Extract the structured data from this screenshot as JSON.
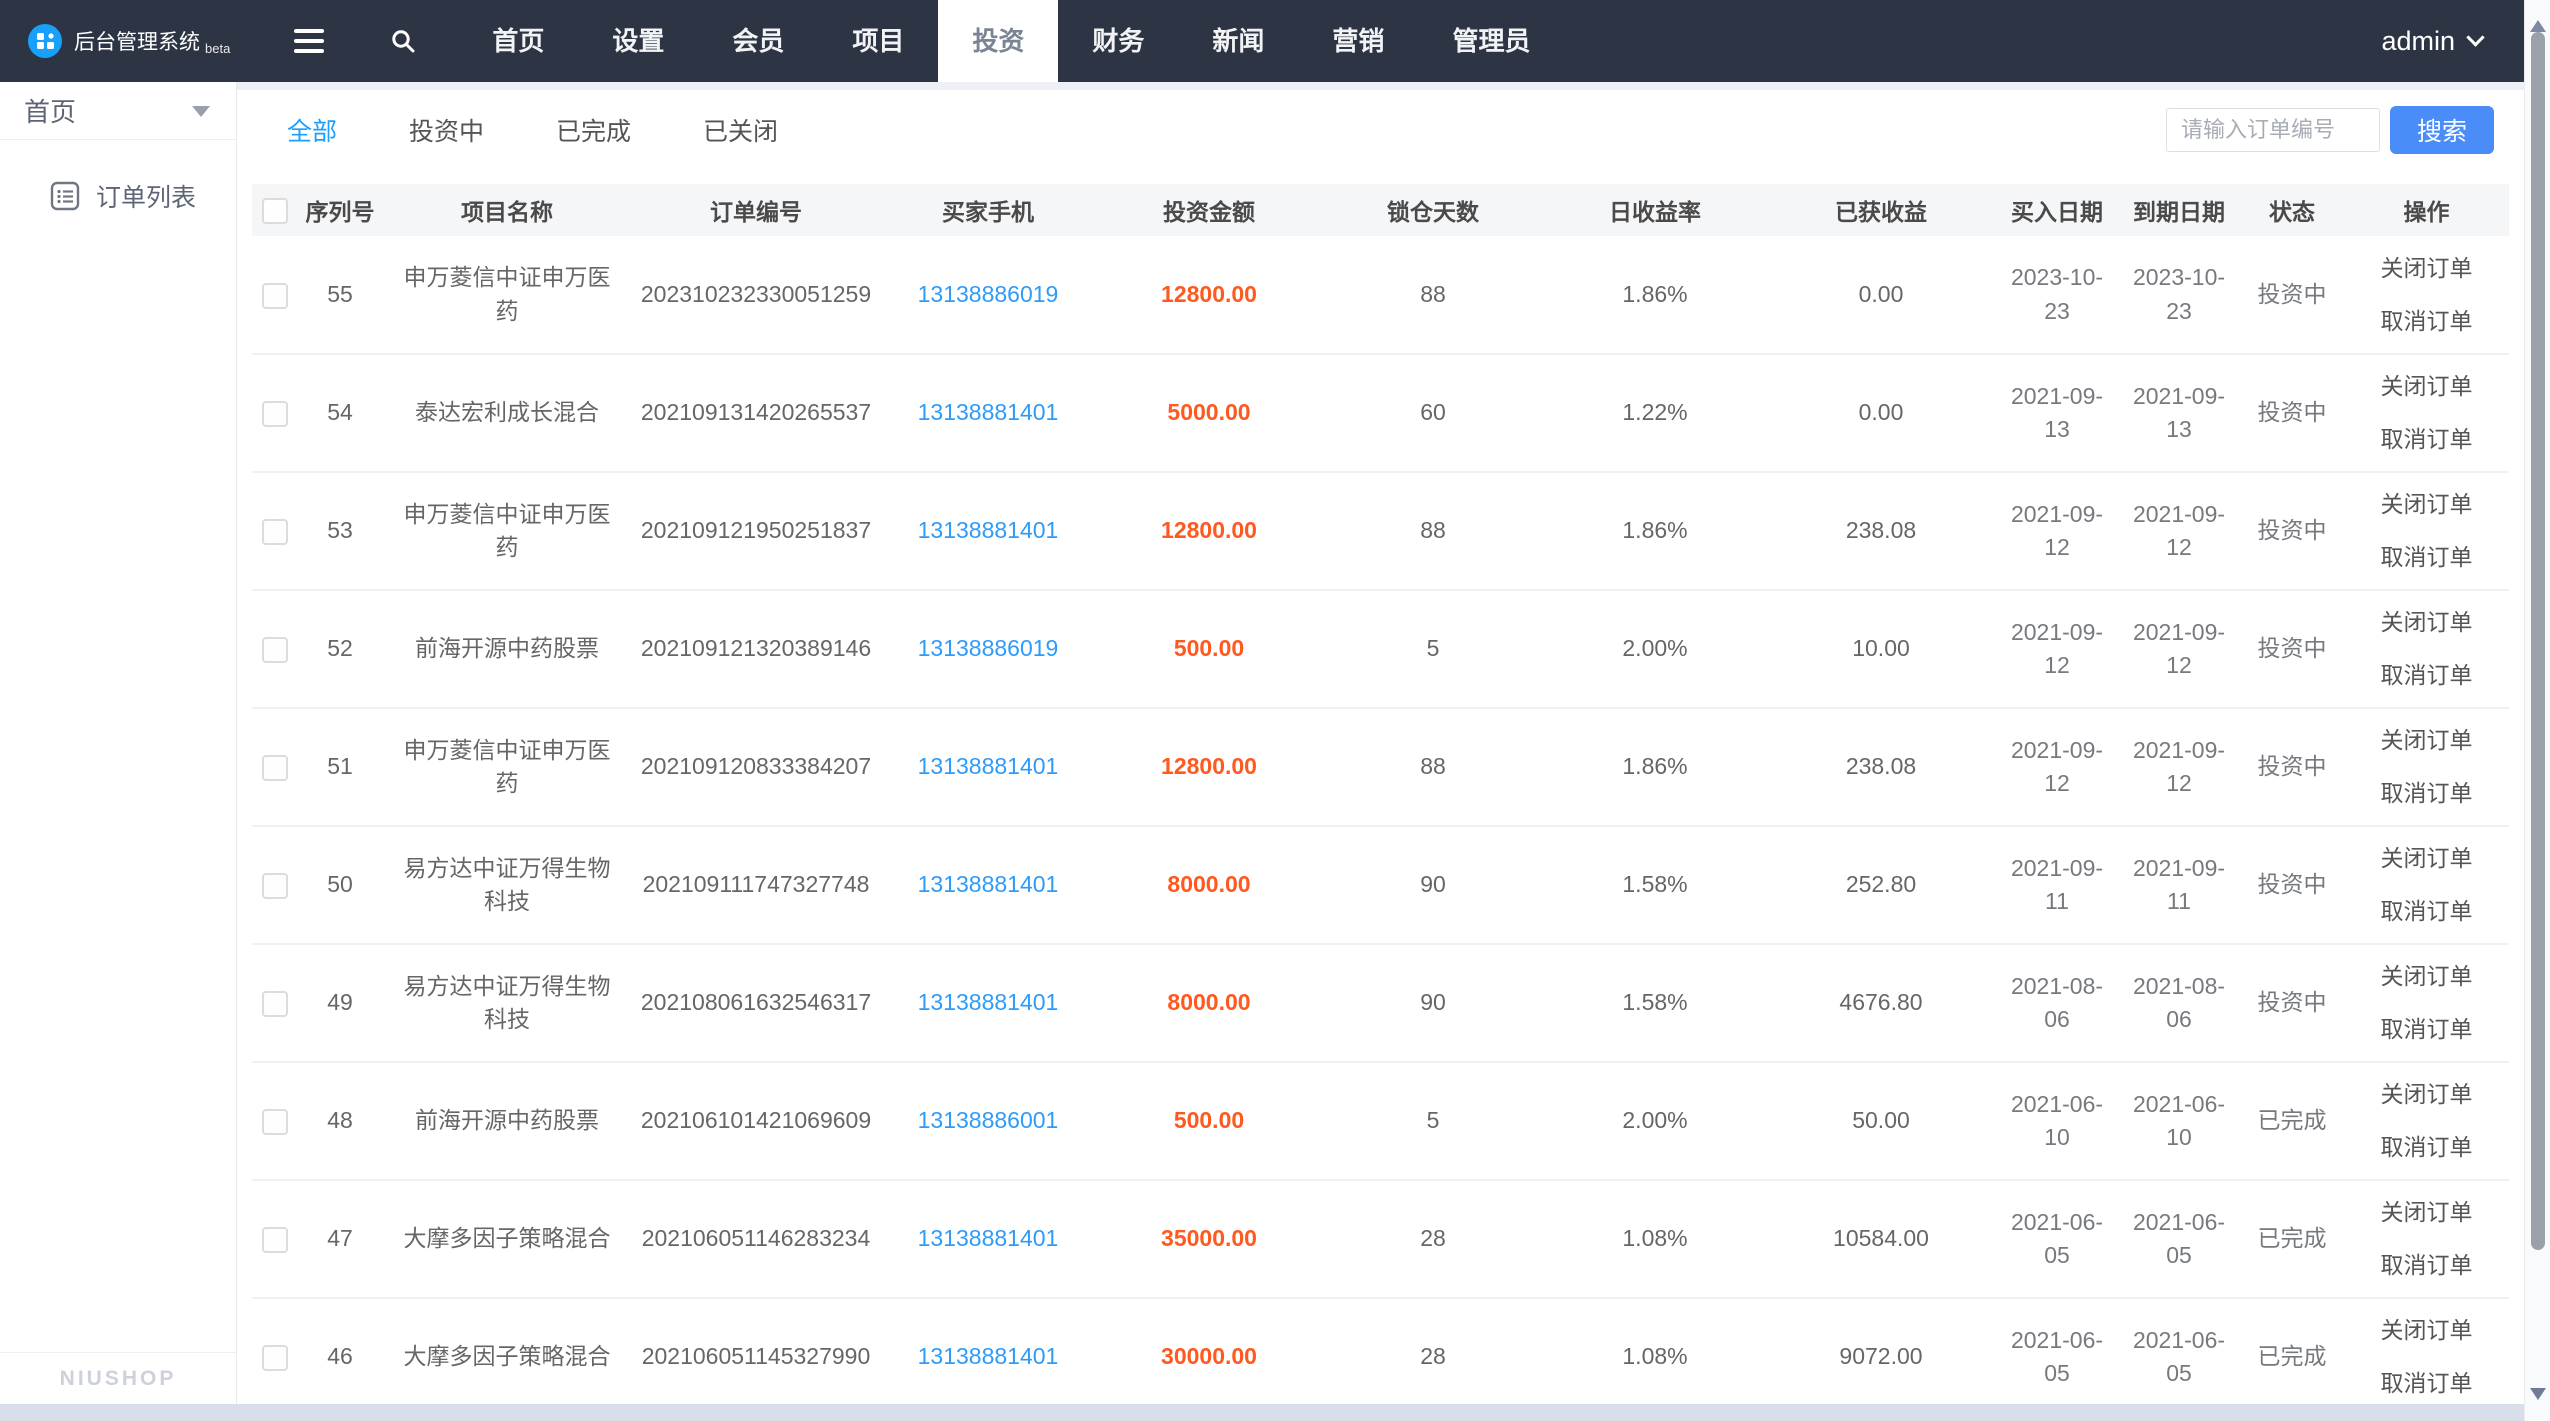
{
  "navbar": {
    "brand": "后台管理系统",
    "brand_badge": "beta",
    "menu": [
      "首页",
      "设置",
      "会员",
      "项目",
      "投资",
      "财务",
      "新闻",
      "营销",
      "管理员"
    ],
    "active_menu": "投资",
    "user": "admin"
  },
  "sidebar": {
    "section": "首页",
    "items": [
      {
        "label": "订单列表"
      }
    ],
    "footer": "NIUSHOP"
  },
  "tabs": [
    {
      "label": "全部",
      "active": true
    },
    {
      "label": "投资中",
      "active": false
    },
    {
      "label": "已完成",
      "active": false
    },
    {
      "label": "已关闭",
      "active": false
    }
  ],
  "search": {
    "placeholder": "请输入订单编号",
    "button": "搜索"
  },
  "table": {
    "headers": [
      "序列号",
      "项目名称",
      "订单编号",
      "买家手机",
      "投资金额",
      "锁仓天数",
      "日收益率",
      "已获收益",
      "买入日期",
      "到期日期",
      "状态",
      "操作"
    ],
    "rows": [
      {
        "seq": "55",
        "project": "申万菱信中证申万医药",
        "order_no": "202310232330051259",
        "phone": "13138886019",
        "amount": "12800.00",
        "days": "88",
        "rate": "1.86%",
        "profit": "0.00",
        "buy_date": "2023-10-23",
        "end_date": "2023-10-23",
        "status": "投资中",
        "actions": [
          "关闭订单",
          "取消订单"
        ]
      },
      {
        "seq": "54",
        "project": "泰达宏利成长混合",
        "order_no": "202109131420265537",
        "phone": "13138881401",
        "amount": "5000.00",
        "days": "60",
        "rate": "1.22%",
        "profit": "0.00",
        "buy_date": "2021-09-13",
        "end_date": "2021-09-13",
        "status": "投资中",
        "actions": [
          "关闭订单",
          "取消订单"
        ]
      },
      {
        "seq": "53",
        "project": "申万菱信中证申万医药",
        "order_no": "202109121950251837",
        "phone": "13138881401",
        "amount": "12800.00",
        "days": "88",
        "rate": "1.86%",
        "profit": "238.08",
        "buy_date": "2021-09-12",
        "end_date": "2021-09-12",
        "status": "投资中",
        "actions": [
          "关闭订单",
          "取消订单"
        ]
      },
      {
        "seq": "52",
        "project": "前海开源中药股票",
        "order_no": "202109121320389146",
        "phone": "13138886019",
        "amount": "500.00",
        "days": "5",
        "rate": "2.00%",
        "profit": "10.00",
        "buy_date": "2021-09-12",
        "end_date": "2021-09-12",
        "status": "投资中",
        "actions": [
          "关闭订单",
          "取消订单"
        ]
      },
      {
        "seq": "51",
        "project": "申万菱信中证申万医药",
        "order_no": "202109120833384207",
        "phone": "13138881401",
        "amount": "12800.00",
        "days": "88",
        "rate": "1.86%",
        "profit": "238.08",
        "buy_date": "2021-09-12",
        "end_date": "2021-09-12",
        "status": "投资中",
        "actions": [
          "关闭订单",
          "取消订单"
        ]
      },
      {
        "seq": "50",
        "project": "易方达中证万得生物科技",
        "order_no": "202109111747327748",
        "phone": "13138881401",
        "amount": "8000.00",
        "days": "90",
        "rate": "1.58%",
        "profit": "252.80",
        "buy_date": "2021-09-11",
        "end_date": "2021-09-11",
        "status": "投资中",
        "actions": [
          "关闭订单",
          "取消订单"
        ]
      },
      {
        "seq": "49",
        "project": "易方达中证万得生物科技",
        "order_no": "202108061632546317",
        "phone": "13138881401",
        "amount": "8000.00",
        "days": "90",
        "rate": "1.58%",
        "profit": "4676.80",
        "buy_date": "2021-08-06",
        "end_date": "2021-08-06",
        "status": "投资中",
        "actions": [
          "关闭订单",
          "取消订单"
        ]
      },
      {
        "seq": "48",
        "project": "前海开源中药股票",
        "order_no": "202106101421069609",
        "phone": "13138886001",
        "amount": "500.00",
        "days": "5",
        "rate": "2.00%",
        "profit": "50.00",
        "buy_date": "2021-06-10",
        "end_date": "2021-06-10",
        "status": "已完成",
        "actions": [
          "关闭订单",
          "取消订单"
        ]
      },
      {
        "seq": "47",
        "project": "大摩多因子策略混合",
        "order_no": "202106051146283234",
        "phone": "13138881401",
        "amount": "35000.00",
        "days": "28",
        "rate": "1.08%",
        "profit": "10584.00",
        "buy_date": "2021-06-05",
        "end_date": "2021-06-05",
        "status": "已完成",
        "actions": [
          "关闭订单",
          "取消订单"
        ]
      },
      {
        "seq": "46",
        "project": "大摩多因子策略混合",
        "order_no": "202106051145327990",
        "phone": "13138881401",
        "amount": "30000.00",
        "days": "28",
        "rate": "1.08%",
        "profit": "9072.00",
        "buy_date": "2021-06-05",
        "end_date": "2021-06-05",
        "status": "已完成",
        "actions": [
          "关闭订单",
          "取消订单"
        ]
      }
    ]
  },
  "colors": {
    "navbar_bg": "#2d3545",
    "accent": "#1E9FFF",
    "button_blue": "#4a8cf8",
    "amount_orange": "#ff591f",
    "link_blue": "#2f9bf8"
  }
}
